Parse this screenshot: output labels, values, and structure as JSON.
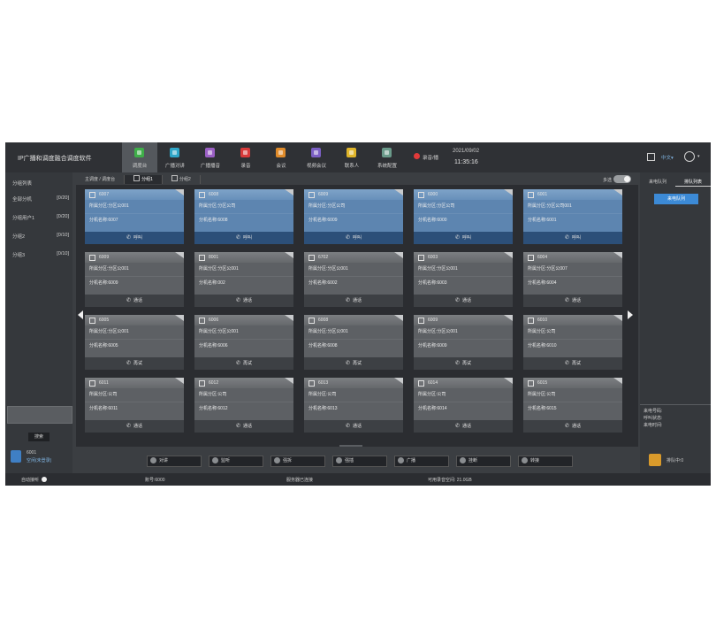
{
  "app": {
    "title": "IP广播和调度融合调度软件",
    "date": "2021/09/02",
    "time": "11:35:16",
    "recording_label": "录音/播",
    "language_label": "中文▾",
    "accent_color": "#3c8ad6"
  },
  "nav": {
    "items": [
      {
        "label": "调度台",
        "color": "#3fae49"
      },
      {
        "label": "广播对讲",
        "color": "#2fa6c8"
      },
      {
        "label": "广播播音",
        "color": "#9a5fc4"
      },
      {
        "label": "录音",
        "color": "#d83a3a"
      },
      {
        "label": "会议",
        "color": "#e08b2a"
      },
      {
        "label": "视频会议",
        "color": "#7b5fc4"
      },
      {
        "label": "联系人",
        "color": "#e0b52a"
      },
      {
        "label": "系统配置",
        "color": "#6a9a8a"
      }
    ]
  },
  "left_panel": {
    "header": "分组列表",
    "groups": [
      {
        "name": "全部分机",
        "count": "[0/20]"
      },
      {
        "name": "分组用户1",
        "count": "[0/20]"
      },
      {
        "name": "分组2",
        "count": "[0/10]"
      },
      {
        "name": "分组3",
        "count": "[0/10]"
      }
    ],
    "button": "搜索",
    "phone_number": "6001",
    "phone_status": "空闲(未登录)"
  },
  "tabs": [
    {
      "label": "主调度 / 调度台"
    },
    {
      "label": "分组1"
    },
    {
      "label": "分组2"
    }
  ],
  "toggle_label": "多选",
  "cards": [
    {
      "num": "6007",
      "line1": "所属分区:分区公001",
      "line2": "分机名称:6007",
      "action": "呼叫"
    },
    {
      "num": "6008",
      "line1": "所属分区:分区公司",
      "line2": "分机名称:6008",
      "action": "呼叫"
    },
    {
      "num": "6009",
      "line1": "所属分区:分区公司",
      "line2": "分机名称:6009",
      "action": "呼叫"
    },
    {
      "num": "6000",
      "line1": "所属分区:分区公司",
      "line2": "分机名称:6000",
      "action": "呼叫"
    },
    {
      "num": "6001",
      "line1": "所属分区:分区公司001",
      "line2": "分机名称:6001",
      "action": "呼叫"
    },
    {
      "num": "6009",
      "line1": "所属分区:分区公001",
      "line2": "分机名称:6009",
      "action": "通话"
    },
    {
      "num": "8001",
      "line1": "所属分区:分区公001",
      "line2": "分机名称:002",
      "action": "通话"
    },
    {
      "num": "6702",
      "line1": "所属分区:分区公001",
      "line2": "分机名称:6002",
      "action": "通话"
    },
    {
      "num": "6003",
      "line1": "所属分区:分区公001",
      "line2": "分机名称:6003",
      "action": "通话"
    },
    {
      "num": "6004",
      "line1": "所属分区:分区公007",
      "line2": "分机名称:6004",
      "action": "通话"
    },
    {
      "num": "6005",
      "line1": "所属分区:分区公001",
      "line2": "分机名称:6005",
      "action": "再试"
    },
    {
      "num": "6006",
      "line1": "所属分区:分区公001",
      "line2": "分机名称:6006",
      "action": "再试"
    },
    {
      "num": "6008",
      "line1": "所属分区:分区公001",
      "line2": "分机名称:6008",
      "action": "再试"
    },
    {
      "num": "6009",
      "line1": "所属分区:分区公001",
      "line2": "分机名称:6009",
      "action": "再试"
    },
    {
      "num": "6010",
      "line1": "所属分区:公司",
      "line2": "分机名称:6010",
      "action": "再试"
    },
    {
      "num": "6011",
      "line1": "所属分区:公司",
      "line2": "分机名称:6011",
      "action": "通话"
    },
    {
      "num": "6012",
      "line1": "所属分区:公司",
      "line2": "分机名称:6012",
      "action": "通话"
    },
    {
      "num": "6013",
      "line1": "所属分区:公司",
      "line2": "分机名称:6013",
      "action": "通话"
    },
    {
      "num": "6014",
      "line1": "所属分区:公司",
      "line2": "分机名称:6014",
      "action": "通话"
    },
    {
      "num": "6015",
      "line1": "所属分区:公司",
      "line2": "分机名称:6015",
      "action": "通话"
    }
  ],
  "actions": [
    {
      "label": "对讲"
    },
    {
      "label": "监听"
    },
    {
      "label": "强拆"
    },
    {
      "label": "强插"
    },
    {
      "label": "广播"
    },
    {
      "label": "挂断"
    },
    {
      "label": "转接"
    }
  ],
  "right_panel": {
    "tabs": [
      {
        "label": "来电队列"
      },
      {
        "label": "排队列表"
      }
    ],
    "button": "来电队列",
    "info_lines": [
      "来电号码:",
      "呼叫状态:",
      "来电时间:"
    ],
    "phone_label": "排队中:0"
  },
  "status_bar": {
    "auto_label": "自动接听",
    "item2": "账号:6000",
    "item3": "服务器已连接",
    "item4": "可用录音空间: 21.0GB"
  }
}
